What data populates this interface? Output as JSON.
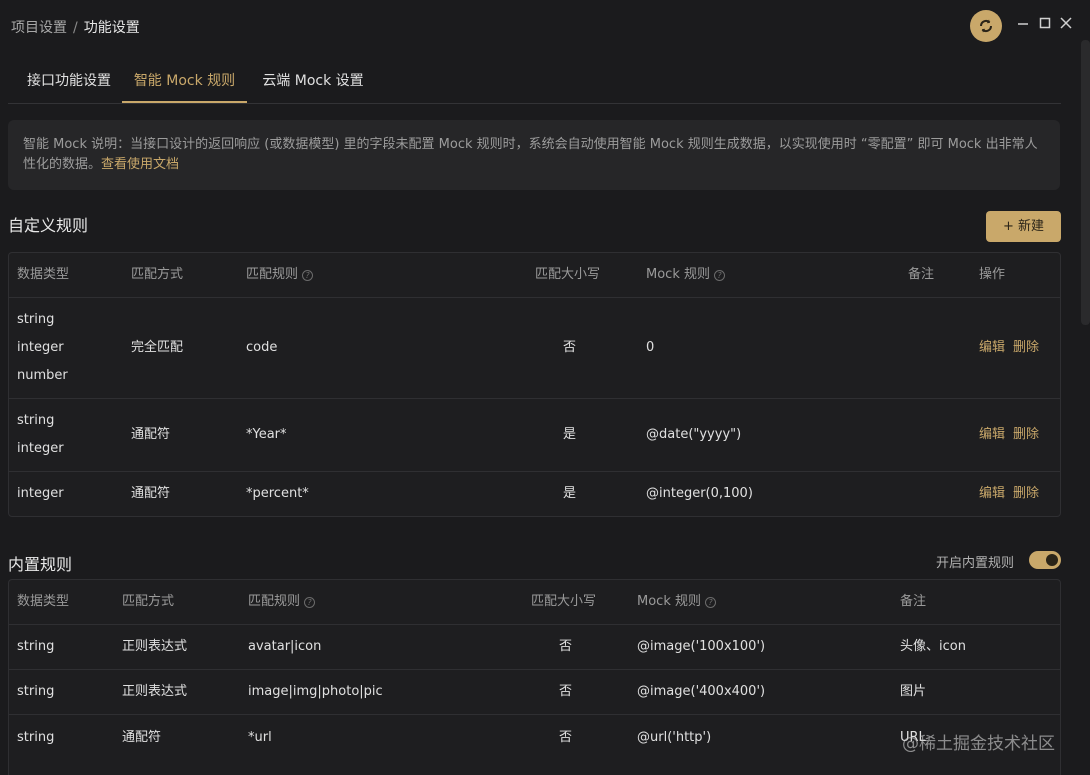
{
  "breadcrumb": {
    "parent": "项目设置",
    "separator": "/",
    "current": "功能设置"
  },
  "tabs": [
    {
      "label": "接口功能设置"
    },
    {
      "label": "智能 Mock 规则"
    },
    {
      "label": "云端 Mock 设置"
    }
  ],
  "notice": {
    "text": "智能 Mock 说明：当接口设计的返回响应 (或数据模型) 里的字段未配置 Mock 规则时，系统会自动使用智能 Mock 规则生成数据，以实现使用时 “零配置” 即可 Mock 出非常人性化的数据。",
    "link": "查看使用文档"
  },
  "custom": {
    "title": "自定义规则",
    "new_button": "新建",
    "headers": [
      "数据类型",
      "匹配方式",
      "匹配规则",
      "匹配大小写",
      "Mock 规则",
      "备注",
      "操作"
    ],
    "rows": [
      {
        "types": [
          "string",
          "integer",
          "number"
        ],
        "match": "完全匹配",
        "rule": "code",
        "case": "否",
        "mock": "0",
        "note": "",
        "edit": "编辑",
        "delete": "删除"
      },
      {
        "types": [
          "string",
          "integer"
        ],
        "match": "通配符",
        "rule": "*Year*",
        "case": "是",
        "mock": "@date(\"yyyy\")",
        "note": "",
        "edit": "编辑",
        "delete": "删除"
      },
      {
        "types": [
          "integer"
        ],
        "match": "通配符",
        "rule": "*percent*",
        "case": "是",
        "mock": "@integer(0,100)",
        "note": "",
        "edit": "编辑",
        "delete": "删除"
      }
    ]
  },
  "builtin": {
    "title": "内置规则",
    "toggle_label": "开启内置规则",
    "toggle_on": true,
    "headers": [
      "数据类型",
      "匹配方式",
      "匹配规则",
      "匹配大小写",
      "Mock 规则",
      "备注"
    ],
    "rows": [
      {
        "type": "string",
        "match": "正则表达式",
        "rule": "avatar|icon",
        "case": "否",
        "mock": "@image('100x100')",
        "note": "头像、icon"
      },
      {
        "type": "string",
        "match": "正则表达式",
        "rule": "image|img|photo|pic",
        "case": "否",
        "mock": "@image('400x400')",
        "note": "图片"
      },
      {
        "type": "string",
        "match": "通配符",
        "rule": "*url",
        "case": "否",
        "mock": "@url('http')",
        "note": "URL"
      }
    ]
  },
  "watermark": "@稀土掘金技术社区",
  "colors": {
    "accent": "#c9a86a",
    "background": "#1b1b1d",
    "panel": "#262628"
  }
}
